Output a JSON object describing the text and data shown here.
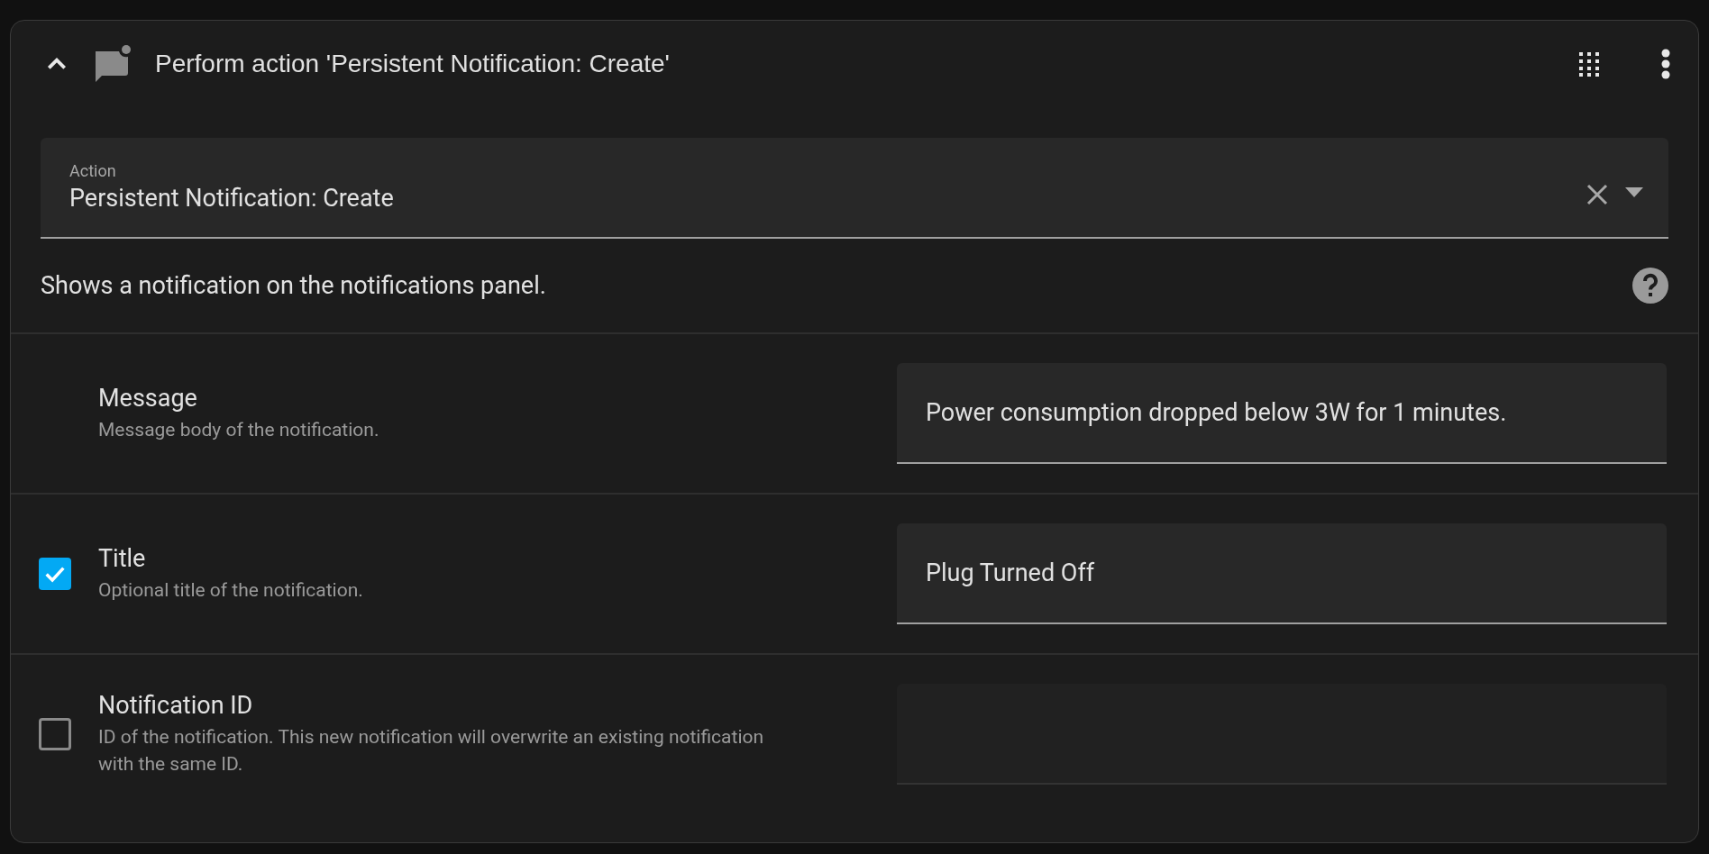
{
  "header": {
    "title": "Perform action 'Persistent Notification: Create'",
    "expanded": true
  },
  "action_field": {
    "label": "Action",
    "value": "Persistent Notification: Create"
  },
  "description": "Shows a notification on the notifications panel.",
  "fields": [
    {
      "kind": "required",
      "label": "Message",
      "description": "Message body of the notification.",
      "value": "Power consumption dropped below 3W for 1 minutes.",
      "disabled": false
    },
    {
      "kind": "optional",
      "checked": true,
      "label": "Title",
      "description": "Optional title of the notification.",
      "value": "Plug Turned Off",
      "disabled": false
    },
    {
      "kind": "optional",
      "checked": false,
      "label": "Notification ID",
      "description": "ID of the notification. This new notification will overwrite an existing notification with the same ID.",
      "disabled": true
    }
  ]
}
